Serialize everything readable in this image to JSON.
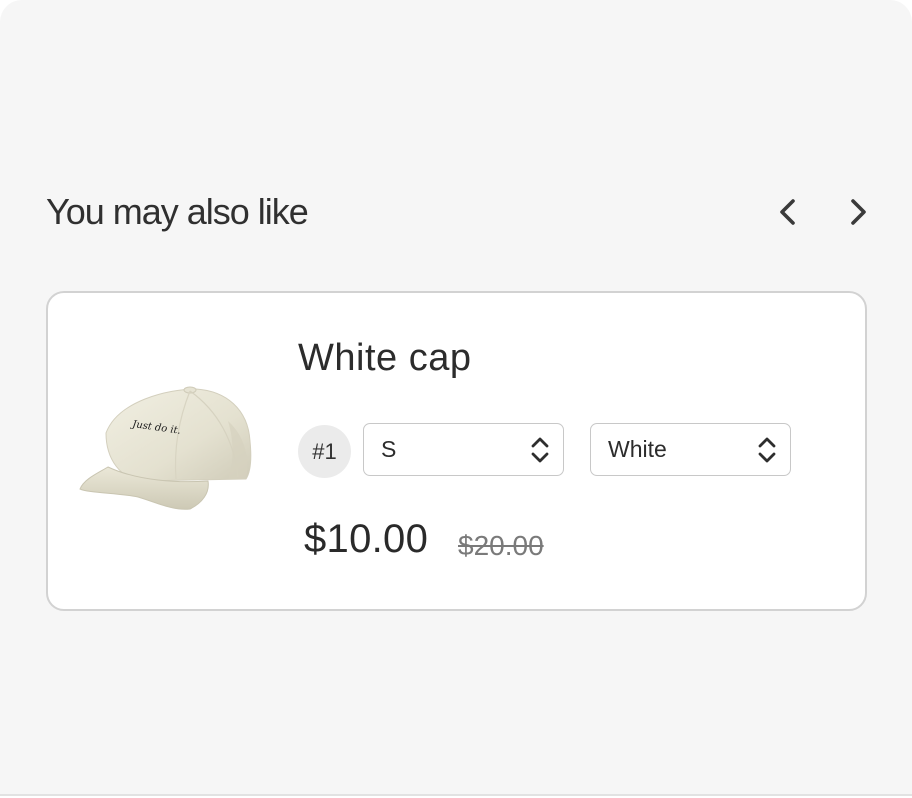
{
  "section": {
    "title": "You may also like"
  },
  "nav": {
    "prev_icon": "chevron-left-icon",
    "next_icon": "chevron-right-icon"
  },
  "product": {
    "title": "White cap",
    "image_icon": "cap-image",
    "image_text": "Just do it.",
    "rank": "#1",
    "size_value": "S",
    "color_value": "White",
    "price": "$10.00",
    "compare_price": "$20.00"
  },
  "colors": {
    "panel_bg": "#f6f6f6",
    "card_border": "#d2d2d2",
    "badge_bg": "#ebebeb",
    "text": "#2c2c2c",
    "muted_text": "#7a7a7a"
  }
}
